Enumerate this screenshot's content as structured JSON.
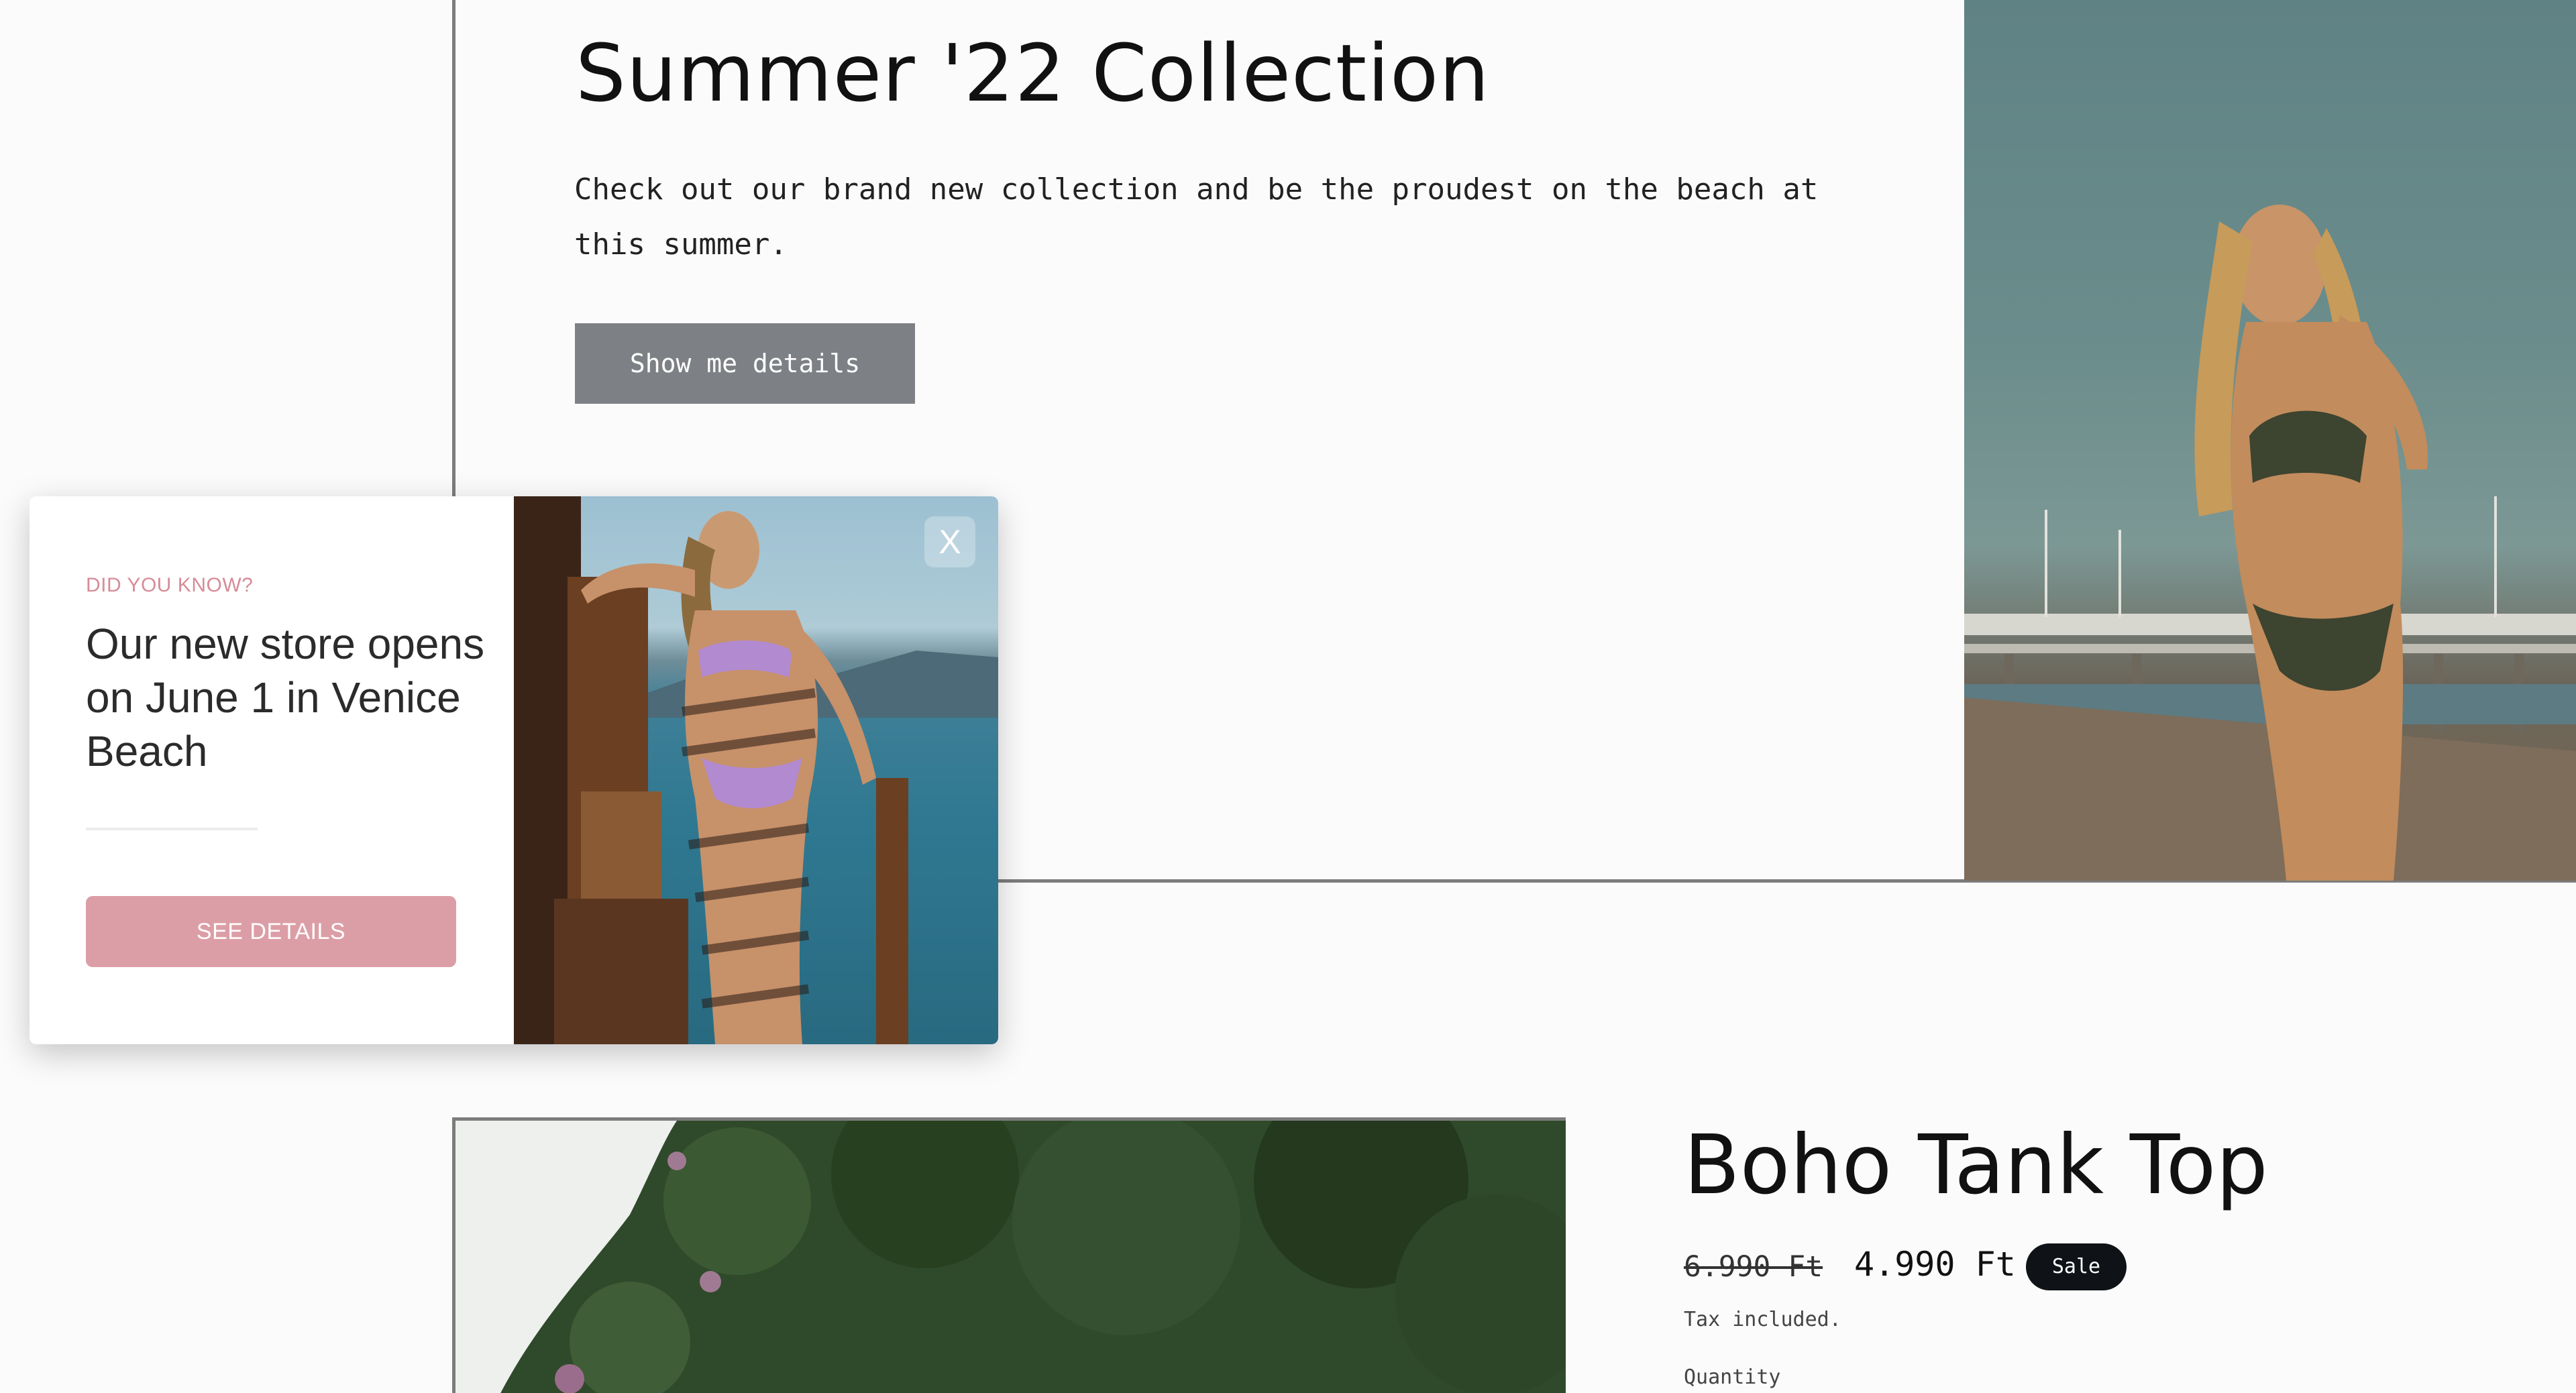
{
  "hero": {
    "title": "Summer '22 Collection",
    "description": "Check out our brand new collection and be the proudest on the beach at this summer.",
    "button_label": "Show me details",
    "button_color": "#7d8084"
  },
  "popup": {
    "eyebrow": "DID YOU KNOW?",
    "headline": "Our new store opens on June 1 in Venice Beach",
    "button_label": "SEE DETAILS",
    "close_label": "X",
    "accent_color": "#dc9ea6"
  },
  "product": {
    "title": "Boho Tank Top",
    "price_original": "6.990 Ft",
    "price_sale": "4.990 Ft",
    "sale_badge": "Sale",
    "tax_note": "Tax included.",
    "quantity_label": "Quantity"
  },
  "icons": {
    "close": "close-icon"
  }
}
